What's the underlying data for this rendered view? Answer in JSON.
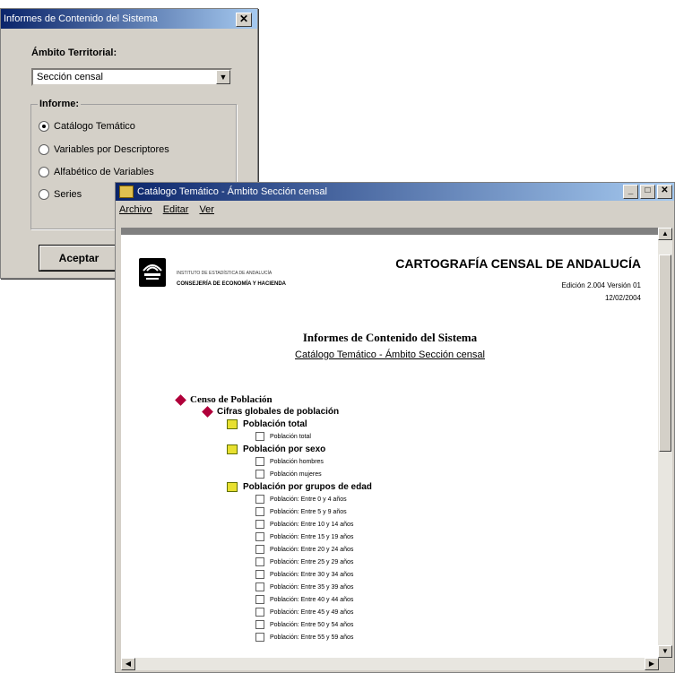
{
  "dialog": {
    "title": "Informes de Contenido del Sistema",
    "close_glyph": "✕",
    "ambito_label": "Ámbito Territorial:",
    "combo_value": "Sección censal",
    "combo_arrow": "▼",
    "informe_label": "Informe:",
    "options": [
      {
        "label": "Catálogo Temático",
        "selected": true
      },
      {
        "label": "Variables por Descriptores",
        "selected": false
      },
      {
        "label": "Alfabético de Variables",
        "selected": false
      },
      {
        "label": "Series",
        "selected": false
      }
    ],
    "accept_label": "Aceptar"
  },
  "window": {
    "title": "Catálogo Temático - Ámbito Sección censal",
    "buttons": [
      "_",
      "□",
      "✕"
    ],
    "menu": [
      "Archivo",
      "Editar",
      "Ver"
    ]
  },
  "document": {
    "institute": "INSTITUTO DE ESTADÍSTICA DE ANDALUCÍA",
    "consejeria": "CONSEJERÍA DE ECONOMÍA Y HACIENDA",
    "main_title": "CARTOGRAFÍA CENSAL DE ANDALUCÍA",
    "edition": "Edición 2.004 Versión 01",
    "date": "12/02/2004",
    "report_title": "Informes de Contenido del Sistema",
    "report_subtitle": "Catálogo Temático - Ámbito Sección censal",
    "tree": [
      {
        "level": 0,
        "icon": "cube",
        "label": "Censo de Población"
      },
      {
        "level": 1,
        "icon": "cube",
        "label": "Cifras globales de población"
      },
      {
        "level": 2,
        "icon": "folder",
        "label": "Población total"
      },
      {
        "level": 3,
        "icon": "leaf",
        "label": "Población total"
      },
      {
        "level": 2,
        "icon": "folder",
        "label": "Población por sexo"
      },
      {
        "level": 3,
        "icon": "leaf",
        "label": "Población hombres"
      },
      {
        "level": 3,
        "icon": "leaf",
        "label": "Población mujeres"
      },
      {
        "level": 2,
        "icon": "folder",
        "label": "Población por grupos de edad"
      },
      {
        "level": 3,
        "icon": "leaf",
        "label": "Población: Entre 0 y 4 años"
      },
      {
        "level": 3,
        "icon": "leaf",
        "label": "Población: Entre 5 y 9 años"
      },
      {
        "level": 3,
        "icon": "leaf",
        "label": "Población: Entre 10 y 14 años"
      },
      {
        "level": 3,
        "icon": "leaf",
        "label": "Población: Entre 15 y 19 años"
      },
      {
        "level": 3,
        "icon": "leaf",
        "label": "Población: Entre 20 y 24 años"
      },
      {
        "level": 3,
        "icon": "leaf",
        "label": "Población: Entre 25 y 29 años"
      },
      {
        "level": 3,
        "icon": "leaf",
        "label": "Población: Entre 30 y 34 años"
      },
      {
        "level": 3,
        "icon": "leaf",
        "label": "Población: Entre 35 y 39 años"
      },
      {
        "level": 3,
        "icon": "leaf",
        "label": "Población: Entre 40 y 44 años"
      },
      {
        "level": 3,
        "icon": "leaf",
        "label": "Población: Entre 45 y 49 años"
      },
      {
        "level": 3,
        "icon": "leaf",
        "label": "Población: Entre 50 y 54 años"
      },
      {
        "level": 3,
        "icon": "leaf",
        "label": "Población: Entre 55 y 59 años"
      }
    ]
  }
}
